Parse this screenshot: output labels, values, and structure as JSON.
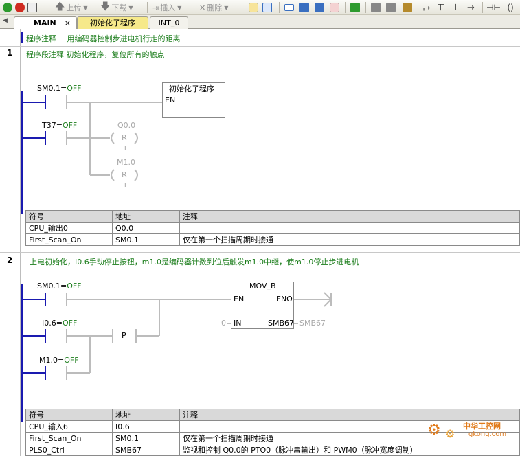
{
  "toolbar": {
    "upload_label": "上传",
    "download_label": "下载",
    "insert_label": "插入",
    "delete_label": "删除"
  },
  "tabs": [
    {
      "label": "MAIN"
    },
    {
      "label": "初始化子程序"
    },
    {
      "label": "INT_0"
    }
  ],
  "program_comment": {
    "label": "程序注释",
    "text": "用编码器控制步进电机行走的距离"
  },
  "network1": {
    "number": "1",
    "comment": "程序段注释   初始化程序，复位所有的触点",
    "contact1_addr": "SM0.1",
    "contact1_eq": "=",
    "contact1_val": "OFF",
    "contact2_addr": "T37",
    "contact2_eq": "=",
    "contact2_val": "OFF",
    "subroutine_title": "初始化子程序",
    "subroutine_en": "EN",
    "coil1_addr": "Q0.0",
    "coil1_type": "R",
    "coil1_n": "1",
    "coil2_addr": "M1.0",
    "coil2_type": "R",
    "coil2_n": "1",
    "symbols": {
      "headers": [
        "符号",
        "地址",
        "注释"
      ],
      "rows": [
        [
          "CPU_输出0",
          "Q0.0",
          ""
        ],
        [
          "First_Scan_On",
          "SM0.1",
          "仅在第一个扫描周期时接通"
        ]
      ]
    }
  },
  "network2": {
    "number": "2",
    "comment": "上电初始化，I0.6手动停止按钮，m1.0是编码器计数到位后触发m1.0中继，使m1.0停止步进电机",
    "contact1_addr": "SM0.1",
    "contact1_eq": "=",
    "contact1_val": "OFF",
    "contact2_addr": "I0.6",
    "contact2_eq": "=",
    "contact2_val": "OFF",
    "contact3_addr": "M1.0",
    "contact3_eq": "=",
    "contact3_val": "OFF",
    "p_label": "P",
    "mov_title": "MOV_B",
    "mov_en": "EN",
    "mov_eno": "ENO",
    "mov_in": "IN",
    "mov_out": "SMB67",
    "in_value": "0",
    "out_value": "SMB67",
    "symbols": {
      "headers": [
        "符号",
        "地址",
        "注释"
      ],
      "rows": [
        [
          "CPU_输入6",
          "I0.6",
          ""
        ],
        [
          "First_Scan_On",
          "SM0.1",
          "仅在第一个扫描周期时接通"
        ],
        [
          "PLS0_Ctrl",
          "SMB67",
          "监视和控制 Q0.0的 PTO0（脉冲串输出）和 PWM0（脉冲宽度调制）"
        ]
      ]
    }
  },
  "watermark": {
    "brand": "中华工控网",
    "url": "gkong.com"
  },
  "colors": {
    "rail": "#1a1ab0",
    "comment_green": "#1b7d1b",
    "tab_yellow": "#f6e98a"
  }
}
